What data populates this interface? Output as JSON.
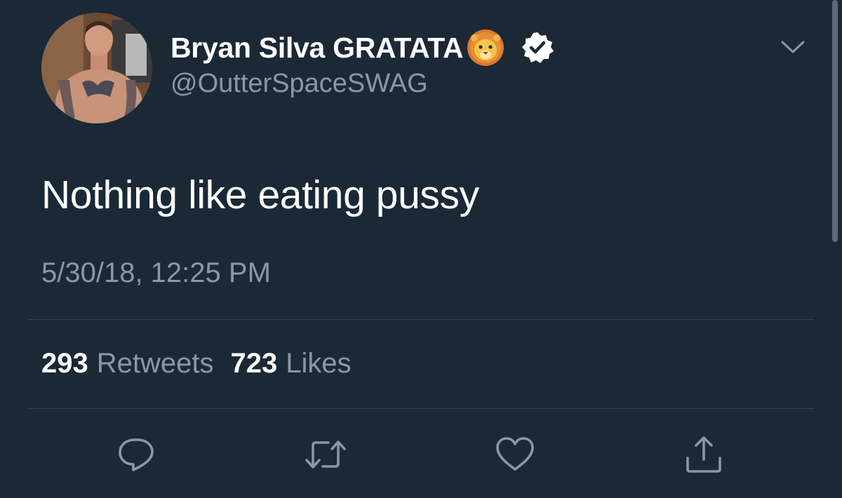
{
  "tweet": {
    "author": {
      "display_name": "Bryan Silva GRATATA",
      "name_emoji": "lion-face",
      "verified": true,
      "handle": "@OutterSpaceSWAG"
    },
    "text": "Nothing like eating pussy",
    "timestamp": "5/30/18, 12:25 PM",
    "stats": {
      "retweets_count": "293",
      "retweets_label": "Retweets",
      "likes_count": "723",
      "likes_label": "Likes"
    },
    "actions": [
      "reply-icon",
      "retweet-icon",
      "like-icon",
      "share-icon"
    ]
  },
  "colors": {
    "background": "#1b2836",
    "primary_text": "#ffffff",
    "secondary_text": "#8899a6",
    "divider": "#38444d",
    "icon": "#8899a6"
  }
}
